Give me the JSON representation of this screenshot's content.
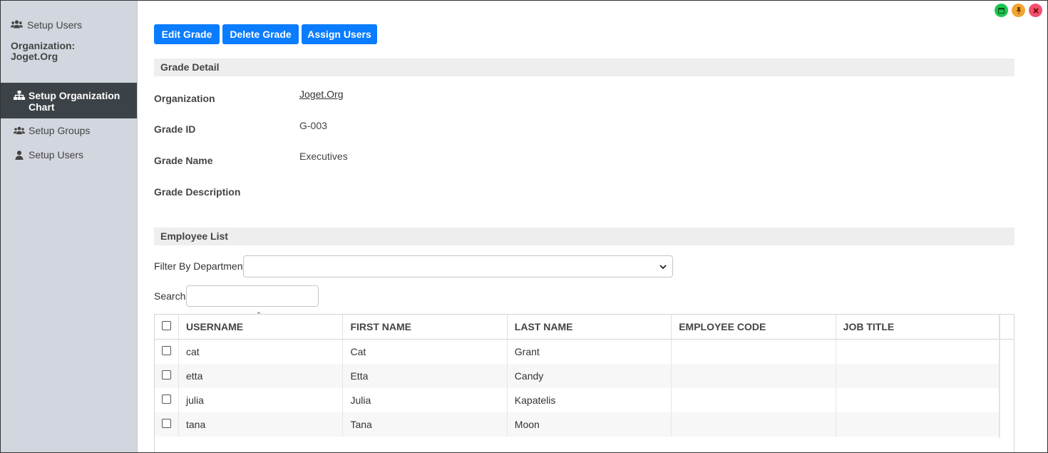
{
  "sidebar": {
    "header_label": "Setup Users",
    "org_label": "Organization:",
    "org_name": "Joget.Org",
    "items": [
      {
        "label": "Setup Organization Chart",
        "active": true,
        "icon": "sitemap-icon"
      },
      {
        "label": "Setup Groups",
        "active": false,
        "icon": "users-icon"
      },
      {
        "label": "Setup Users",
        "active": false,
        "icon": "user-icon"
      }
    ]
  },
  "window_controls": [
    "minimize-icon",
    "pin-icon",
    "close-icon"
  ],
  "toolbar": {
    "edit_label": "Edit Grade",
    "delete_label": "Delete Grade",
    "assign_label": "Assign Users",
    "accent": "#0a7cff"
  },
  "grade_detail": {
    "heading": "Grade Detail",
    "organization_label": "Organization",
    "organization_value": "Joget.Org",
    "grade_id_label": "Grade ID",
    "grade_id_value": "G-003",
    "grade_name_label": "Grade Name",
    "grade_name_value": "Executives",
    "grade_description_label": "Grade Description",
    "grade_description_value": ""
  },
  "employee_list": {
    "heading": "Employee List",
    "filter_label": "Filter By Department",
    "filter_value": "",
    "search_label": "Search",
    "search_value": "",
    "columns": [
      "USERNAME",
      "FIRST NAME",
      "LAST NAME",
      "EMPLOYEE CODE",
      "JOB TITLE"
    ],
    "rows": [
      {
        "username": "cat",
        "first_name": "Cat",
        "last_name": "Grant",
        "employee_code": "",
        "job_title": ""
      },
      {
        "username": "etta",
        "first_name": "Etta",
        "last_name": "Candy",
        "employee_code": "",
        "job_title": ""
      },
      {
        "username": "julia",
        "first_name": "Julia",
        "last_name": "Kapatelis",
        "employee_code": "",
        "job_title": ""
      },
      {
        "username": "tana",
        "first_name": "Tana",
        "last_name": "Moon",
        "employee_code": "",
        "job_title": ""
      }
    ]
  }
}
